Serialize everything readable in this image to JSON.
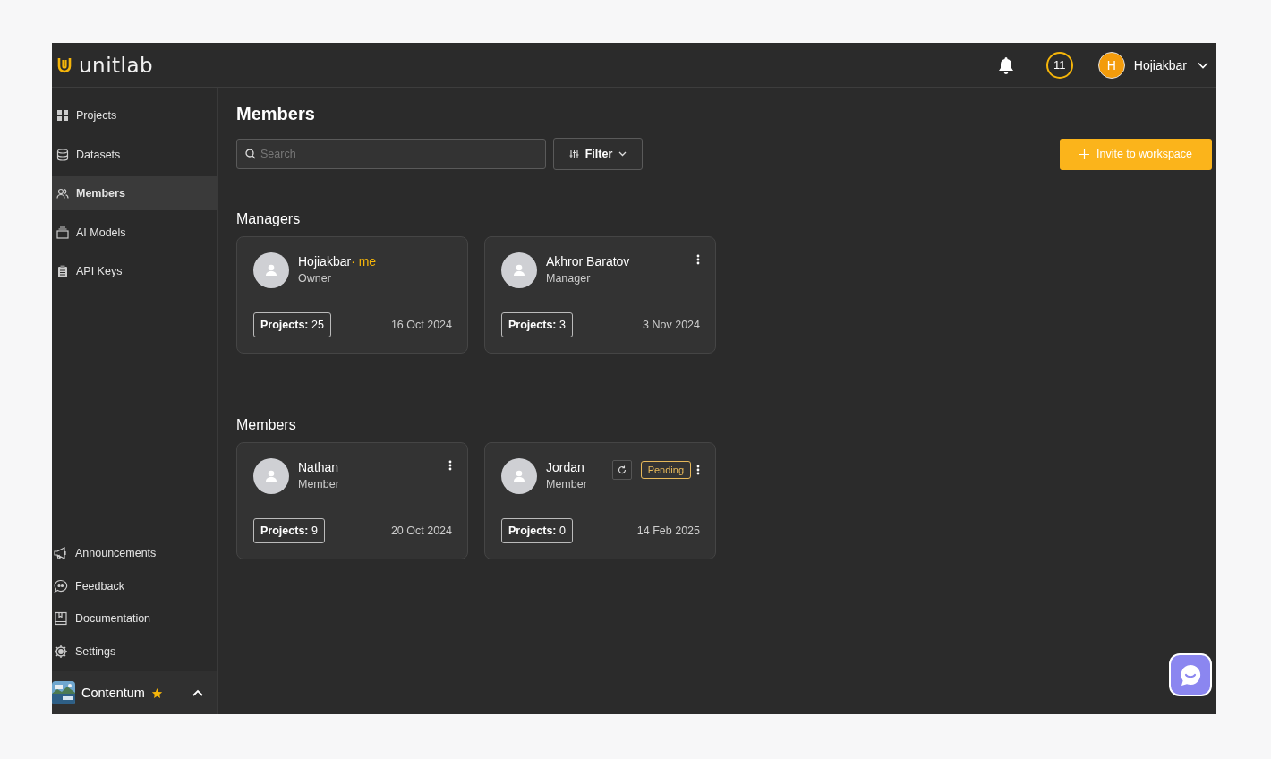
{
  "logo": "unitlab",
  "topbar": {
    "counter": "11",
    "user": {
      "initial": "H",
      "name": "Hojiakbar"
    }
  },
  "sidebar": {
    "items": [
      {
        "label": "Projects",
        "selected": false
      },
      {
        "label": "Datasets",
        "selected": false
      },
      {
        "label": "Members",
        "selected": true
      },
      {
        "label": "AI Models",
        "selected": false
      },
      {
        "label": "API Keys",
        "selected": false
      }
    ],
    "bottom_items": [
      {
        "label": "Announcements"
      },
      {
        "label": "Feedback"
      },
      {
        "label": "Documentation"
      },
      {
        "label": "Settings"
      }
    ],
    "workspace": {
      "name": "Contentum",
      "starred": true
    }
  },
  "page": {
    "title": "Members",
    "search": {
      "placeholder": "Search"
    },
    "filter": "Filter",
    "invite": "Invite to workspace"
  },
  "sections": [
    {
      "title": "Managers",
      "cards": [
        {
          "name": "Hojiakbar",
          "me": "· me",
          "role": "Owner",
          "projects": "**Projects:** 25",
          "date": "16 Oct 2024",
          "menu": false,
          "resend": false
        },
        {
          "name": "Akhror Baratov",
          "role": "Manager",
          "projects": "**Projects:** 3",
          "date": "3 Nov 2024",
          "menu": true,
          "resend": false
        }
      ]
    },
    {
      "title": "Members",
      "cards": [
        {
          "name": "Nathan",
          "role": "Member",
          "projects": "**Projects:** 9",
          "date": "20 Oct 2024",
          "menu": true,
          "resend": false
        },
        {
          "name": "Jordan",
          "role": "Member",
          "projects": "**Projects:** 0",
          "date": "14 Feb 2025",
          "menu": true,
          "resend": true,
          "status": "Pending"
        }
      ]
    }
  ]
}
